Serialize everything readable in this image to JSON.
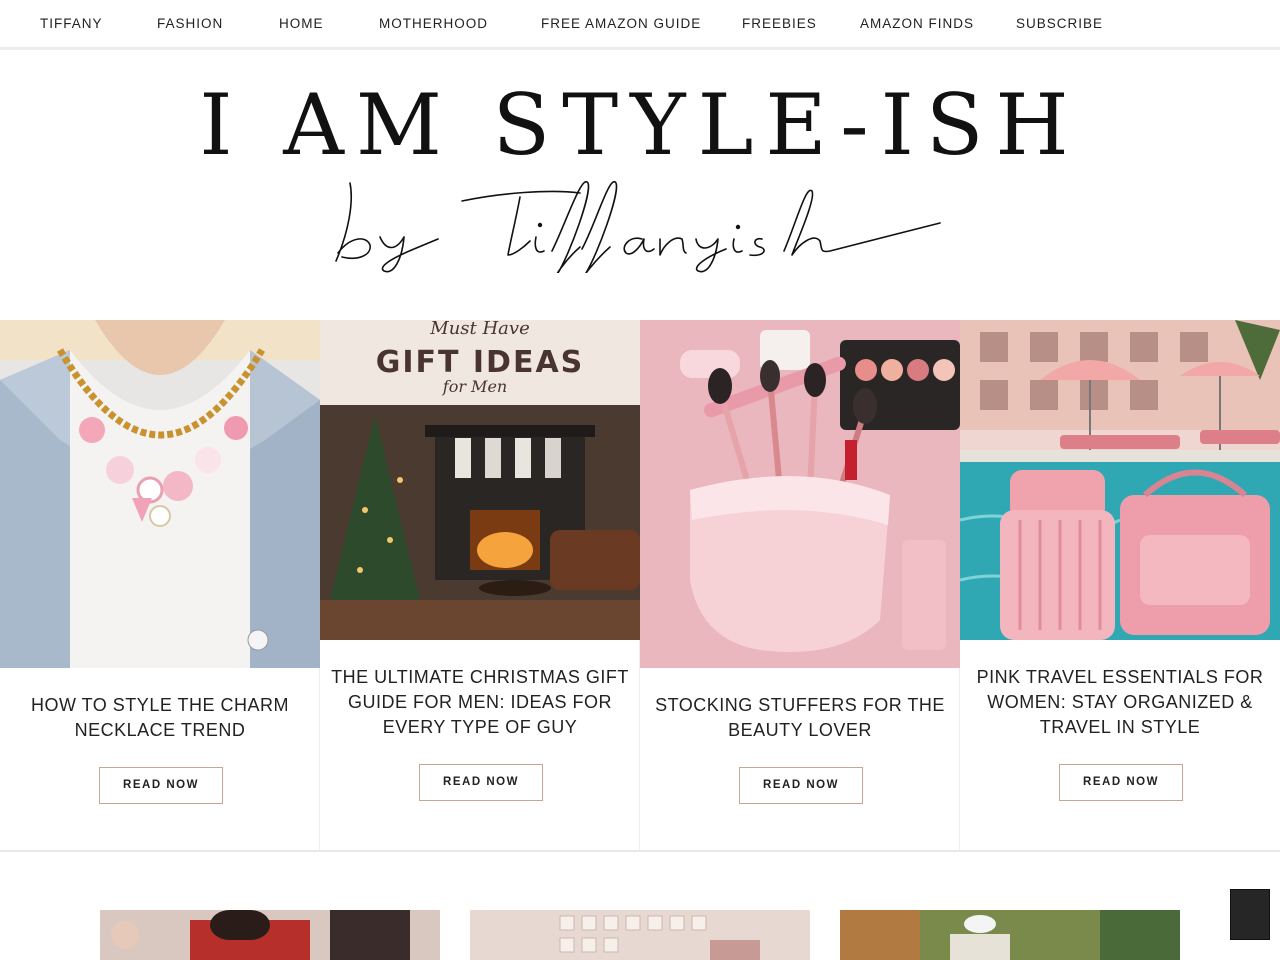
{
  "nav": {
    "items": [
      {
        "label": "TIFFANY"
      },
      {
        "label": "FASHION"
      },
      {
        "label": "HOME"
      },
      {
        "label": "MOTHERHOOD"
      },
      {
        "label": "FREE AMAZON GUIDE"
      },
      {
        "label": "FREEBIES"
      },
      {
        "label": "AMAZON FINDS"
      },
      {
        "label": "SUBSCRIBE"
      }
    ]
  },
  "masthead": {
    "title": "I AM STYLE-ISH",
    "script": "by tiffanyish"
  },
  "featured": [
    {
      "title": "HOW TO STYLE THE CHARM NECKLACE TREND",
      "button": "READ NOW",
      "image": "charm-necklace-photo"
    },
    {
      "title": "THE ULTIMATE CHRISTMAS GIFT GUIDE FOR MEN: IDEAS FOR EVERY TYPE OF GUY",
      "button": "READ NOW",
      "image": "gift-ideas-for-men-photo",
      "image_text": {
        "top": "Must Have",
        "main": "GIFT IDEAS",
        "sub": "for Men"
      }
    },
    {
      "title": "STOCKING STUFFERS FOR THE BEAUTY LOVER",
      "button": "READ NOW",
      "image": "pink-makeup-stocking-photo"
    },
    {
      "title": "PINK TRAVEL ESSENTIALS FOR WOMEN: STAY ORGANIZED & TRAVEL IN STYLE",
      "button": "READ NOW",
      "image": "pink-luggage-poolside-photo"
    }
  ],
  "colors": {
    "button_border": "#c9a692",
    "scroll_top_bg": "#262626"
  },
  "icons": {
    "scroll_top": "scroll-to-top-button"
  }
}
